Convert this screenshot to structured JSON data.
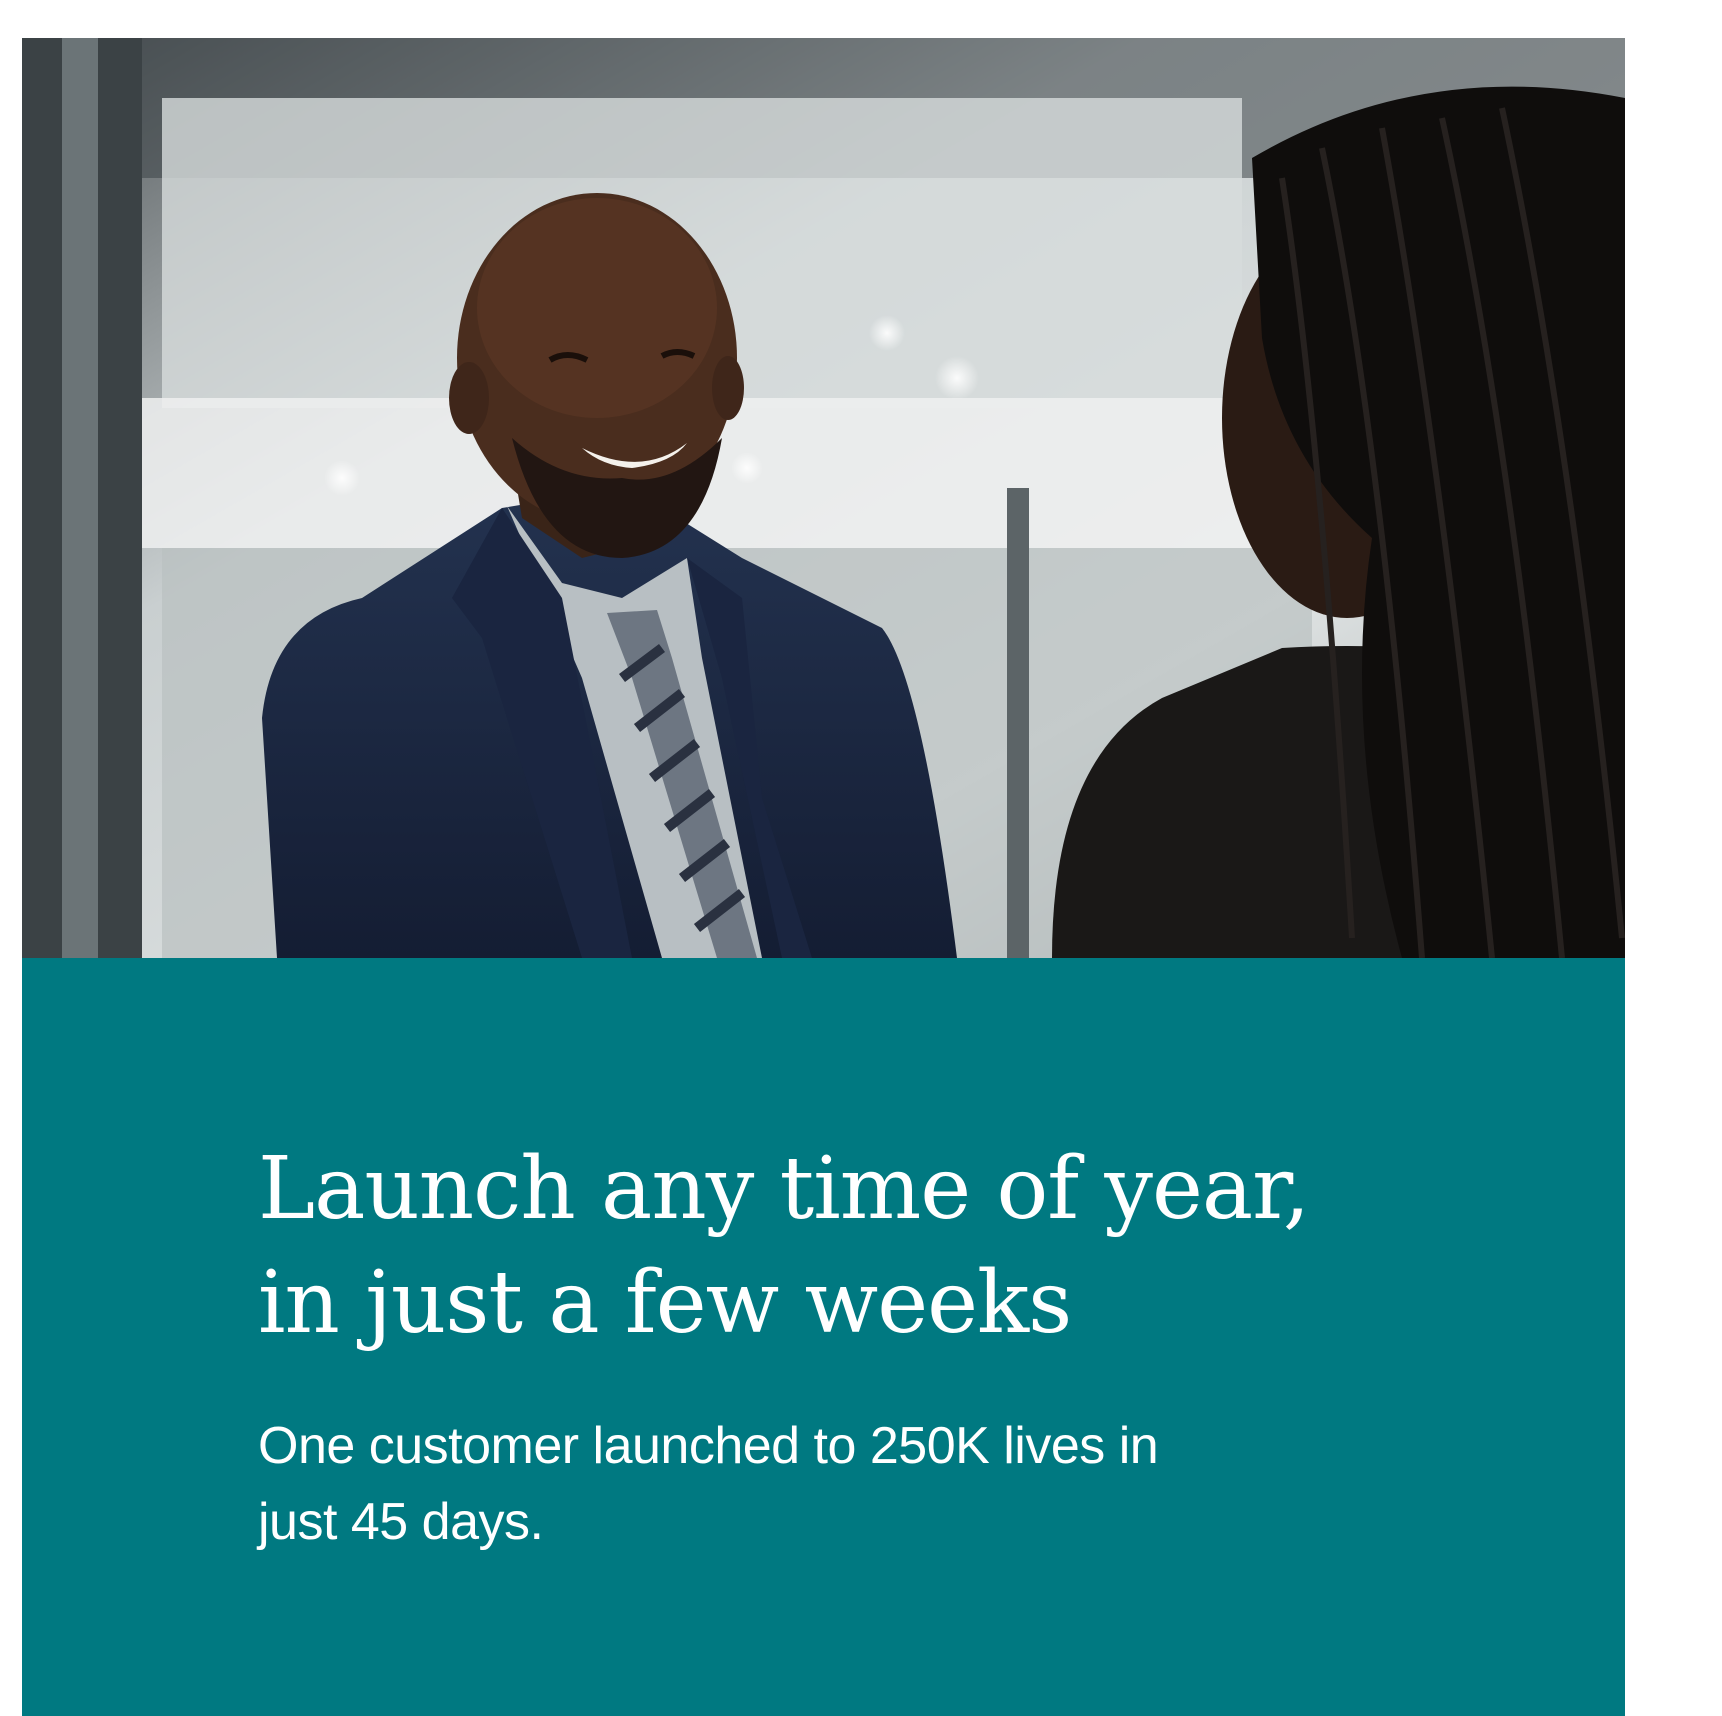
{
  "hero_image": {
    "description_icon": "business-handshake-photo"
  },
  "headline": {
    "line1": "Launch any time of year,",
    "line2": "in just a few weeks"
  },
  "subtext": {
    "line1": "One customer launched to 250K lives in",
    "line2": "just 45 days."
  },
  "colors": {
    "panel": "#007981",
    "text": "#ffffff"
  }
}
